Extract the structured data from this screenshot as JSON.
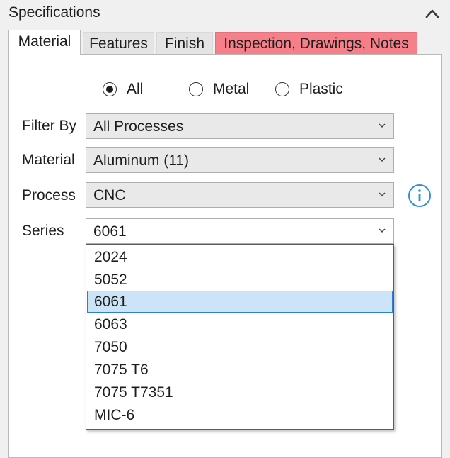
{
  "panel": {
    "title": "Specifications",
    "collapse_icon": "chevron-up-icon"
  },
  "tabs": [
    {
      "label": "Material",
      "active": true
    },
    {
      "label": "Features"
    },
    {
      "label": "Finish"
    },
    {
      "label": "Inspection, Drawings, Notes",
      "alert": true
    }
  ],
  "material_type": {
    "options": [
      "All",
      "Metal",
      "Plastic"
    ],
    "selected": "All"
  },
  "filter_by": {
    "label": "Filter By",
    "value": "All Processes"
  },
  "material": {
    "label": "Material",
    "value": "Aluminum (11)"
  },
  "process": {
    "label": "Process",
    "value": "CNC",
    "info_icon": "info-icon"
  },
  "series": {
    "label": "Series",
    "value": "6061",
    "open": true,
    "options": [
      "2024",
      "5052",
      "6061",
      "6063",
      "7050",
      "7075 T6",
      "7075 T7351",
      "MIC-6"
    ],
    "highlighted": "6061"
  },
  "colors": {
    "alert_tab": "#f5808a",
    "selection_fill": "#cce4f7",
    "selection_border": "#2f7fcf",
    "info_blue": "#2f8fd8"
  }
}
